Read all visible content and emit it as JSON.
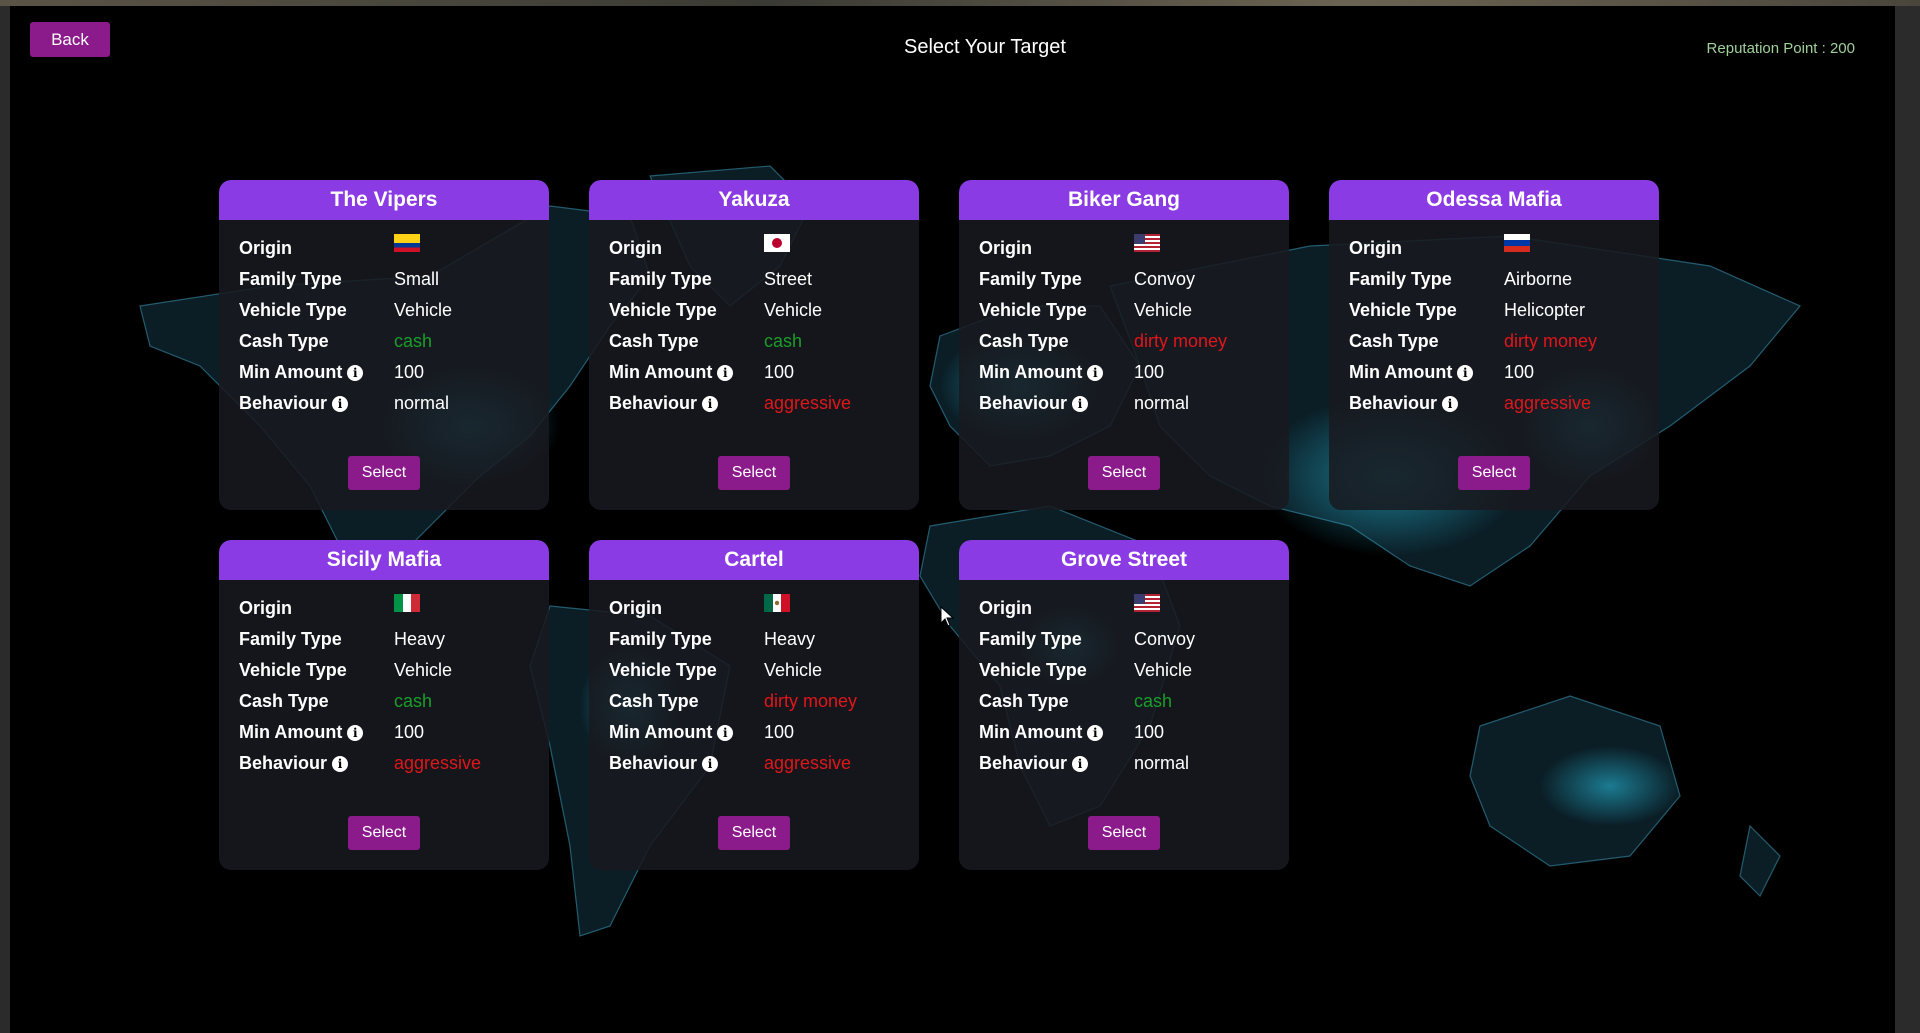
{
  "header": {
    "back_label": "Back",
    "title": "Select Your Target",
    "reputation": "Reputation Point : 200"
  },
  "labels": {
    "origin": "Origin",
    "family_type": "Family Type",
    "vehicle_type": "Vehicle Type",
    "cash_type": "Cash Type",
    "min_amount": "Min Amount",
    "behaviour": "Behaviour",
    "info_glyph": "i"
  },
  "colors": {
    "card_header": "#8a3be3",
    "button": "#8b1a8b",
    "cash_green": "#1a9e2a",
    "dirty_red": "#e0161b",
    "map_glow": "#29c6e8"
  },
  "cards": [
    {
      "name": "The Vipers",
      "origin_flag": "colombia-flag",
      "family_type": "Small",
      "vehicle_type": "Vehicle",
      "cash_type": "cash",
      "min_amount": "100",
      "behaviour": "normal",
      "select_label": "Select"
    },
    {
      "name": "Yakuza",
      "origin_flag": "japan-flag",
      "family_type": "Street",
      "vehicle_type": "Vehicle",
      "cash_type": "cash",
      "min_amount": "100",
      "behaviour": "aggressive",
      "select_label": "Select"
    },
    {
      "name": "Biker Gang",
      "origin_flag": "usa-flag",
      "family_type": "Convoy",
      "vehicle_type": "Vehicle",
      "cash_type": "dirty money",
      "min_amount": "100",
      "behaviour": "normal",
      "select_label": "Select"
    },
    {
      "name": "Odessa Mafia",
      "origin_flag": "russia-flag",
      "family_type": "Airborne",
      "vehicle_type": "Helicopter",
      "cash_type": "dirty money",
      "min_amount": "100",
      "behaviour": "aggressive",
      "select_label": "Select"
    },
    {
      "name": "Sicily Mafia",
      "origin_flag": "italy-flag",
      "family_type": "Heavy",
      "vehicle_type": "Vehicle",
      "cash_type": "cash",
      "min_amount": "100",
      "behaviour": "aggressive",
      "select_label": "Select"
    },
    {
      "name": "Cartel",
      "origin_flag": "mexico-flag",
      "family_type": "Heavy",
      "vehicle_type": "Vehicle",
      "cash_type": "dirty money",
      "min_amount": "100",
      "behaviour": "aggressive",
      "select_label": "Select"
    },
    {
      "name": "Grove Street",
      "origin_flag": "usa-flag",
      "family_type": "Convoy",
      "vehicle_type": "Vehicle",
      "cash_type": "cash",
      "min_amount": "100",
      "behaviour": "normal",
      "select_label": "Select"
    }
  ]
}
